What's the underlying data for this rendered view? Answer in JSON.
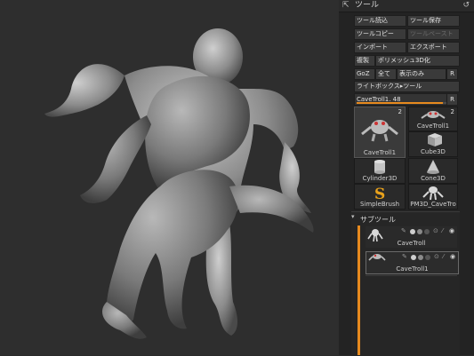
{
  "panel": {
    "title": "ツール",
    "buttons": {
      "load_tool": "ツール読込",
      "save_tool": "ツール保存",
      "copy_tool": "ツールコピー",
      "paste_tool": "ツールペースト",
      "import": "インポート",
      "export": "エクスポート",
      "clone": "複製",
      "make_polymesh": "ポリメッシュ3D化",
      "goz": "GoZ",
      "all": "全て",
      "visible_only": "表示のみ",
      "r1": "R",
      "lightbox": "ライトボックス▸ツール",
      "r2": "R"
    },
    "slider": {
      "label": "CaveTroll1. 48",
      "value": 0.9,
      "r": "R"
    },
    "tools": [
      {
        "label": "CaveTroll1",
        "count": "2"
      },
      {
        "label": "CaveTroll1",
        "count": "2"
      },
      {
        "label": "Cube3D",
        "count": ""
      },
      {
        "label": "Cylinder3D",
        "count": ""
      },
      {
        "label": "Cone3D",
        "count": ""
      },
      {
        "label": "SimpleBrush",
        "count": ""
      },
      {
        "label": "PM3D_CaveTro",
        "count": ""
      }
    ],
    "subtool": {
      "title": "サブツール",
      "items": [
        {
          "name": "CaveTroll"
        },
        {
          "name": "CaveTroll1"
        }
      ]
    },
    "colors": {
      "accent": "#e78a1e",
      "panel_bg": "#232323",
      "viewport_bg": "#2e2e2e"
    }
  }
}
